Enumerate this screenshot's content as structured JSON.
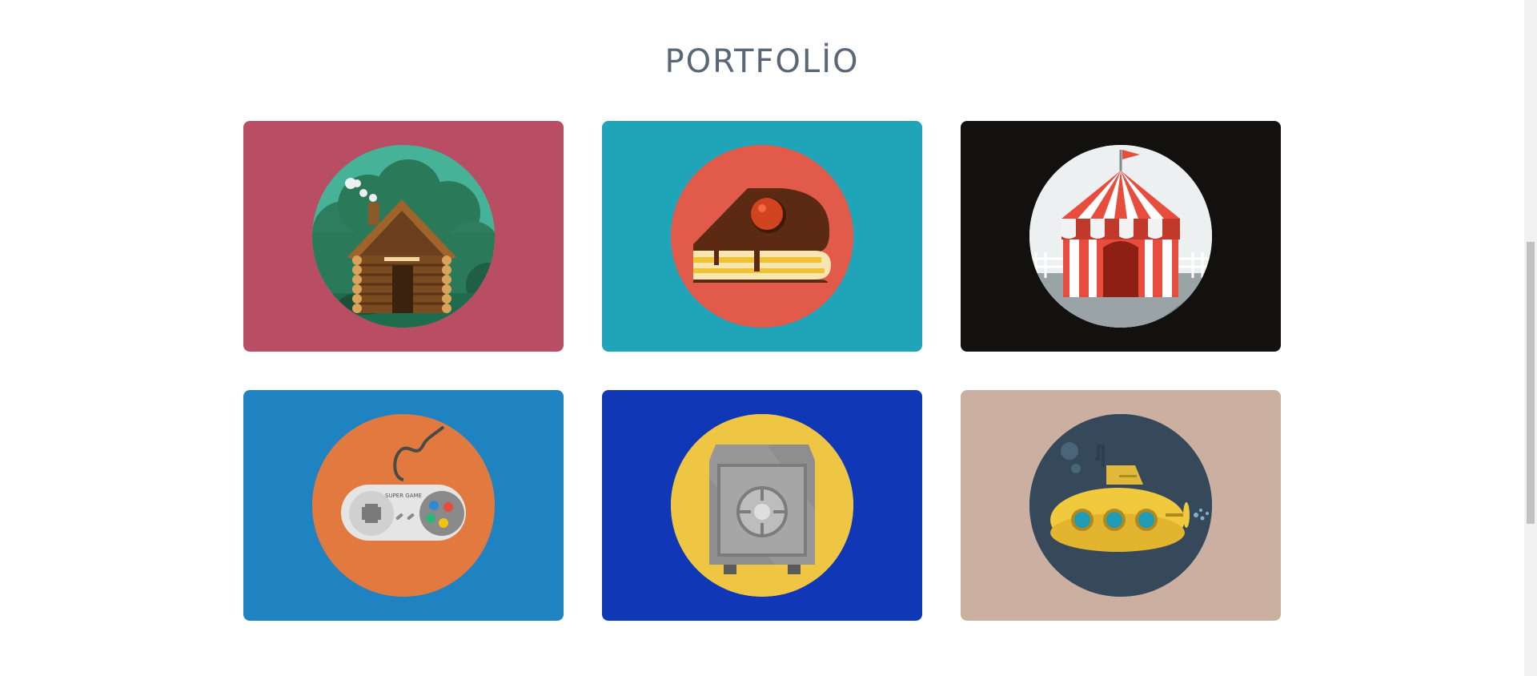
{
  "section": {
    "title": "PORTFOLİO"
  },
  "portfolio": [
    {
      "icon": "log-cabin-icon",
      "bg": "#b94d64",
      "circle": "#46b298"
    },
    {
      "icon": "cake-slice-icon",
      "bg": "#20a4b8",
      "circle": "#e15a4a"
    },
    {
      "icon": "circus-tent-icon",
      "bg": "#131010",
      "circle": "#ecf0f1"
    },
    {
      "icon": "game-controller-icon",
      "bg": "#1f83c1",
      "circle": "#e27a3f",
      "label": "SUPER GAME"
    },
    {
      "icon": "safe-icon",
      "bg": "#1037b6",
      "circle": "#efc644"
    },
    {
      "icon": "submarine-icon",
      "bg": "#cbb0a2",
      "circle": "#35495b"
    }
  ]
}
